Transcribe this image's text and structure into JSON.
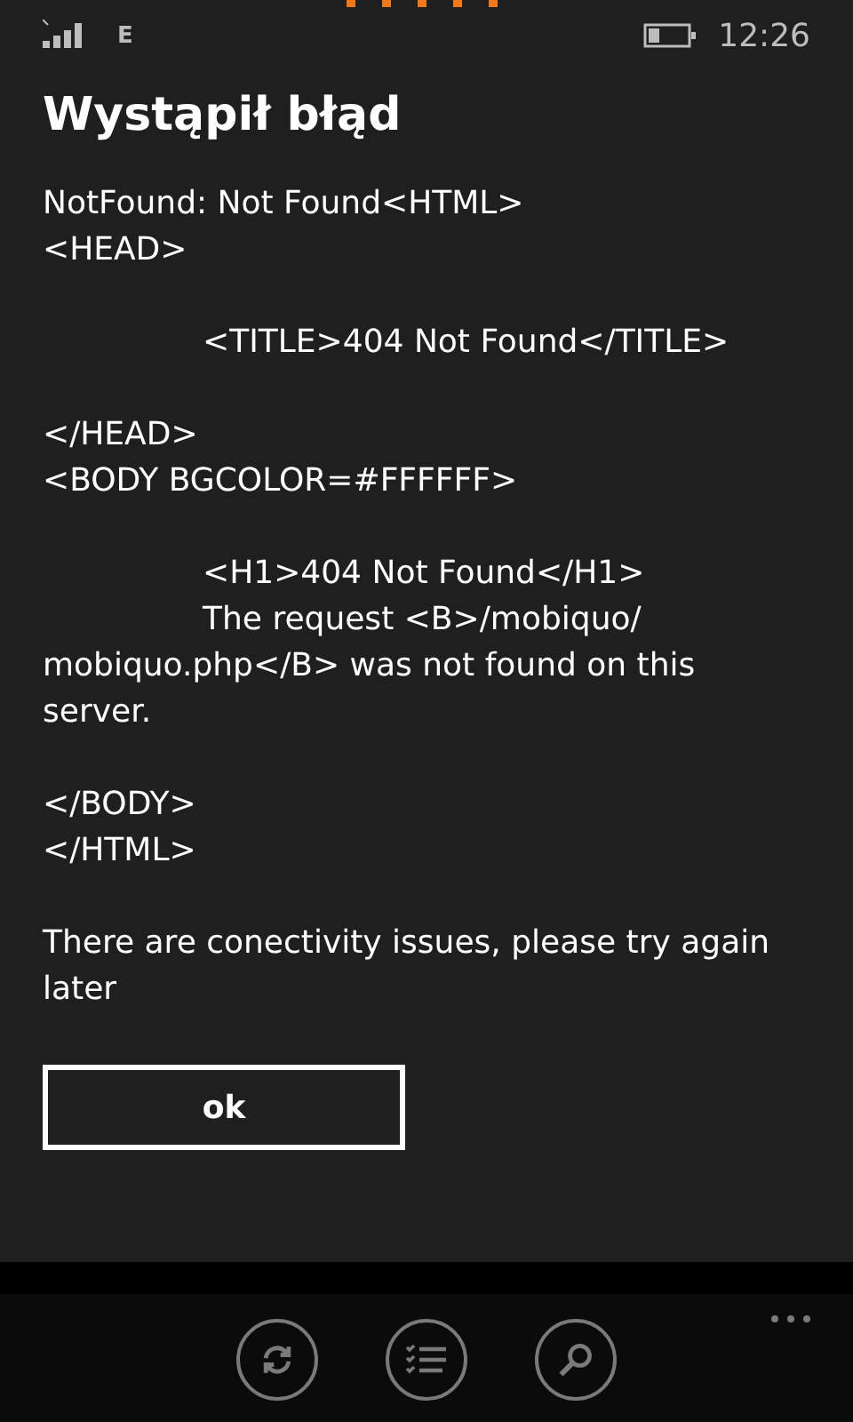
{
  "status_bar": {
    "network": "E",
    "time": "12:26"
  },
  "dialog": {
    "title": "Wystąpił błąd",
    "blocks": [
      [
        {
          "text": "NotFound: Not Found<HTML>",
          "indented": false
        },
        {
          "text": "<HEAD>",
          "indented": false
        }
      ],
      [
        {
          "text": "<TITLE>404 Not Found</TITLE>",
          "indented": true
        }
      ],
      [
        {
          "text": "</HEAD>",
          "indented": false
        },
        {
          "text": "<BODY BGCOLOR=#FFFFFF>",
          "indented": false
        }
      ],
      [
        {
          "text": "<H1>404 Not Found</H1>",
          "indented": true
        },
        {
          "text": "The request <B>/mobiquo/ mobiquo.php</B> was not found on this server.",
          "indented": true
        }
      ],
      [
        {
          "text": "</BODY>",
          "indented": false
        },
        {
          "text": "</HTML>",
          "indented": false
        }
      ],
      [
        {
          "text": "There are conectivity issues, please try again later",
          "indented": false
        }
      ]
    ],
    "button": "ok"
  },
  "app_bar": {
    "buttons": [
      {
        "kind": "refresh"
      },
      {
        "kind": "list"
      },
      {
        "kind": "search"
      }
    ]
  }
}
